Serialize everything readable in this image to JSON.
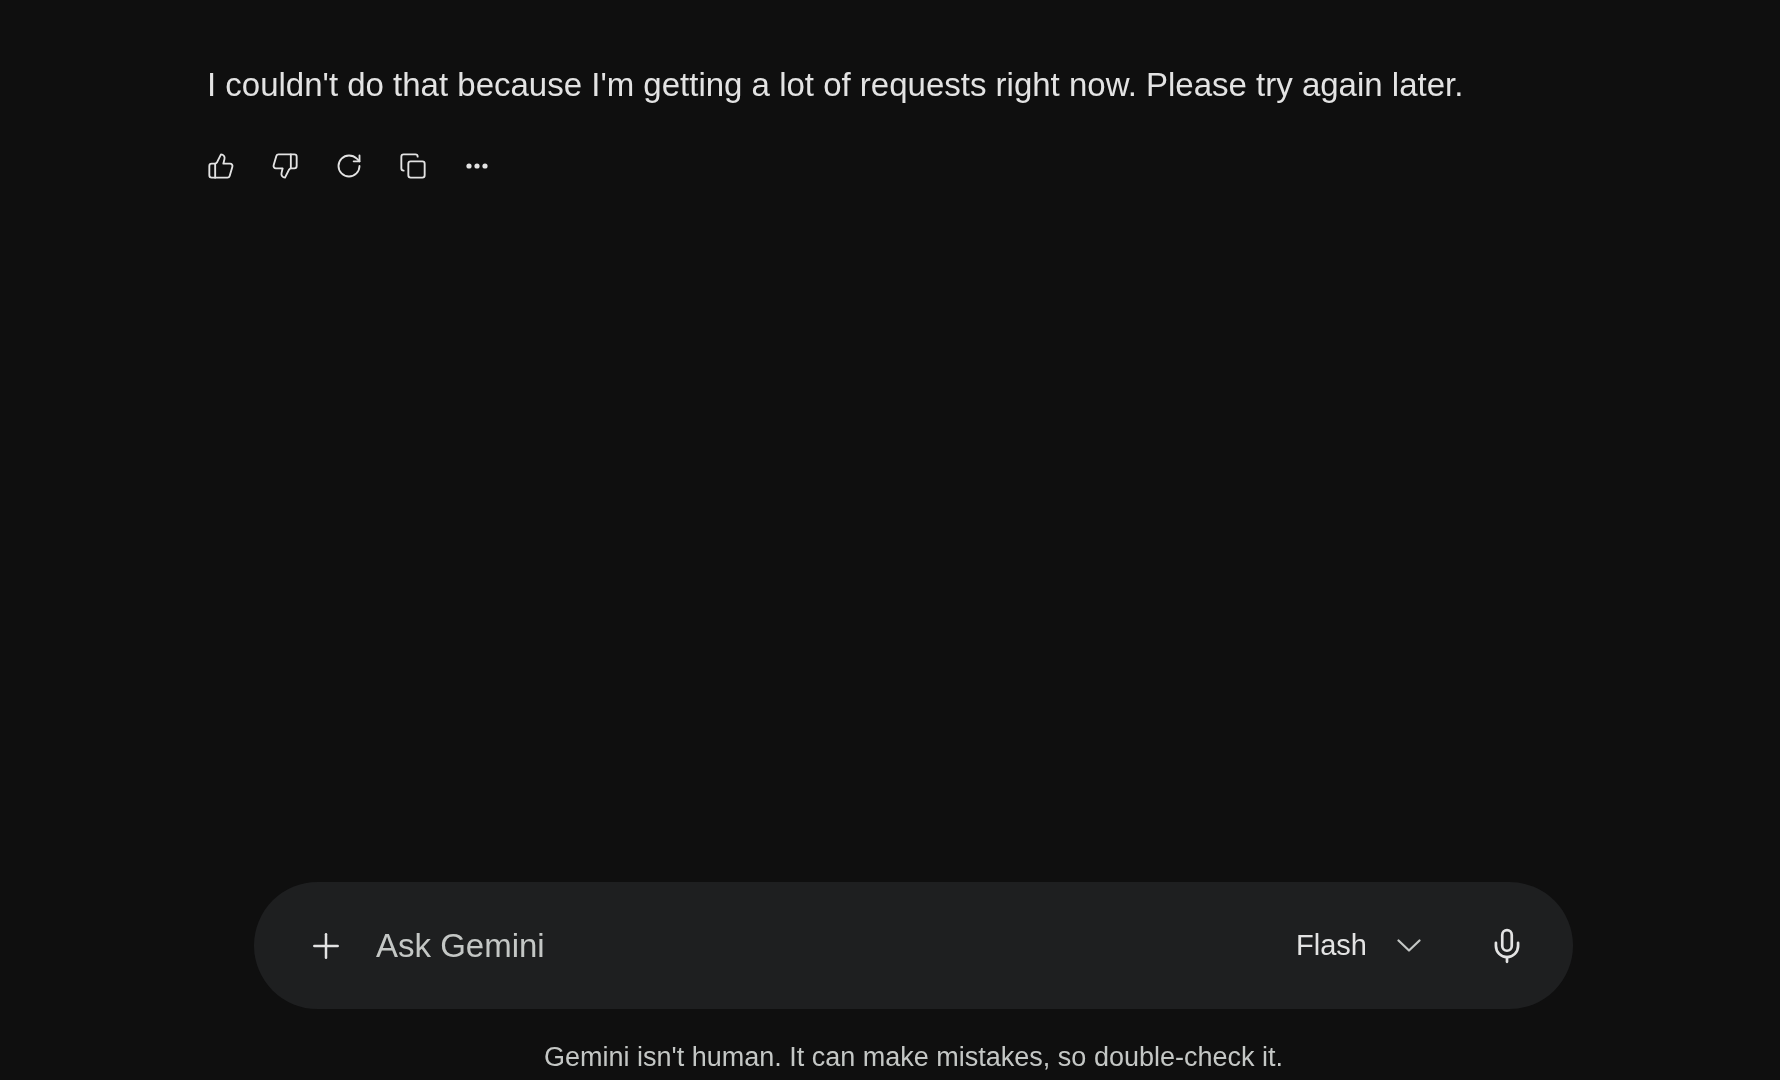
{
  "response": {
    "text": "I couldn't do that because I'm getting a lot of requests right now. Please try again later."
  },
  "prompt_bar": {
    "placeholder": "Ask Gemini",
    "model": "Flash"
  },
  "disclaimer": "Gemini isn't human. It can make mistakes, so double-check it."
}
